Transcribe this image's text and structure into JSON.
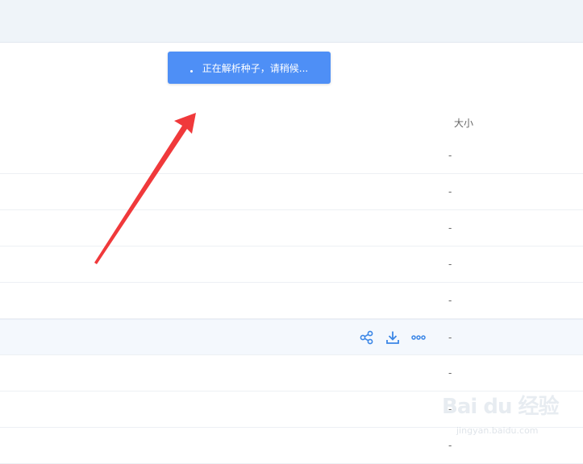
{
  "toast": {
    "message": "正在解析种子，请稍候..."
  },
  "table": {
    "size_header": "大小",
    "rows": [
      {
        "size": "-"
      },
      {
        "size": "-"
      },
      {
        "size": "-"
      },
      {
        "size": "-"
      },
      {
        "size": "-"
      },
      {
        "size": "-"
      },
      {
        "size": "-"
      },
      {
        "size": "-"
      },
      {
        "size": "-"
      }
    ]
  },
  "row_actions": {
    "icons": [
      "share-icon",
      "download-icon",
      "more-icon"
    ]
  },
  "watermark": {
    "brand": "Bai du 经验",
    "url": "jingyan.baidu.com"
  },
  "colors": {
    "toast_bg": "#4e8ff6",
    "action_icon": "#3b86e6",
    "arrow": "#f0393b"
  }
}
